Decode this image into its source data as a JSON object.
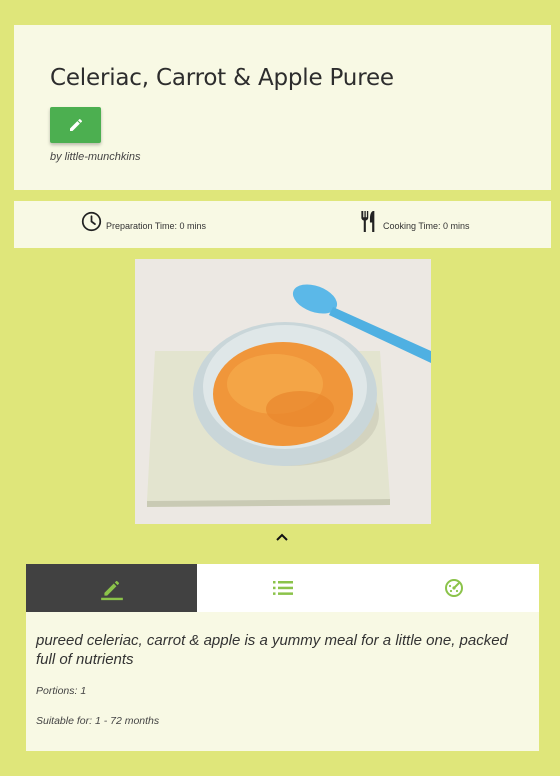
{
  "recipe": {
    "title": "Celeriac, Carrot & Apple Puree",
    "byline": "by little-munchkins",
    "edit_icon": "pencil-icon"
  },
  "times": {
    "prep_label": "Preparation Time: 0 mins",
    "cook_label": "Cooking Time: 0 mins",
    "prep_icon": "clock-icon",
    "cook_icon": "fork-knife-icon"
  },
  "photo": {
    "subject": "bowl of orange puree with a blue spoon"
  },
  "tabs": [
    {
      "icon": "pencil-icon",
      "active": true
    },
    {
      "icon": "list-icon",
      "active": false
    },
    {
      "icon": "nutrition-icon",
      "active": false
    }
  ],
  "details": {
    "description": "pureed celeriac, carrot & apple is a yummy meal for a little one, packed full of nutrients",
    "portions": "Portions: 1",
    "suitable_for": "Suitable for: 1 - 72 months"
  },
  "colors": {
    "background": "#dfe67a",
    "card": "#f8f9e4",
    "accent_green": "#4caf50",
    "tab_active": "#414141",
    "tab_icon_green": "#8bc34a"
  }
}
